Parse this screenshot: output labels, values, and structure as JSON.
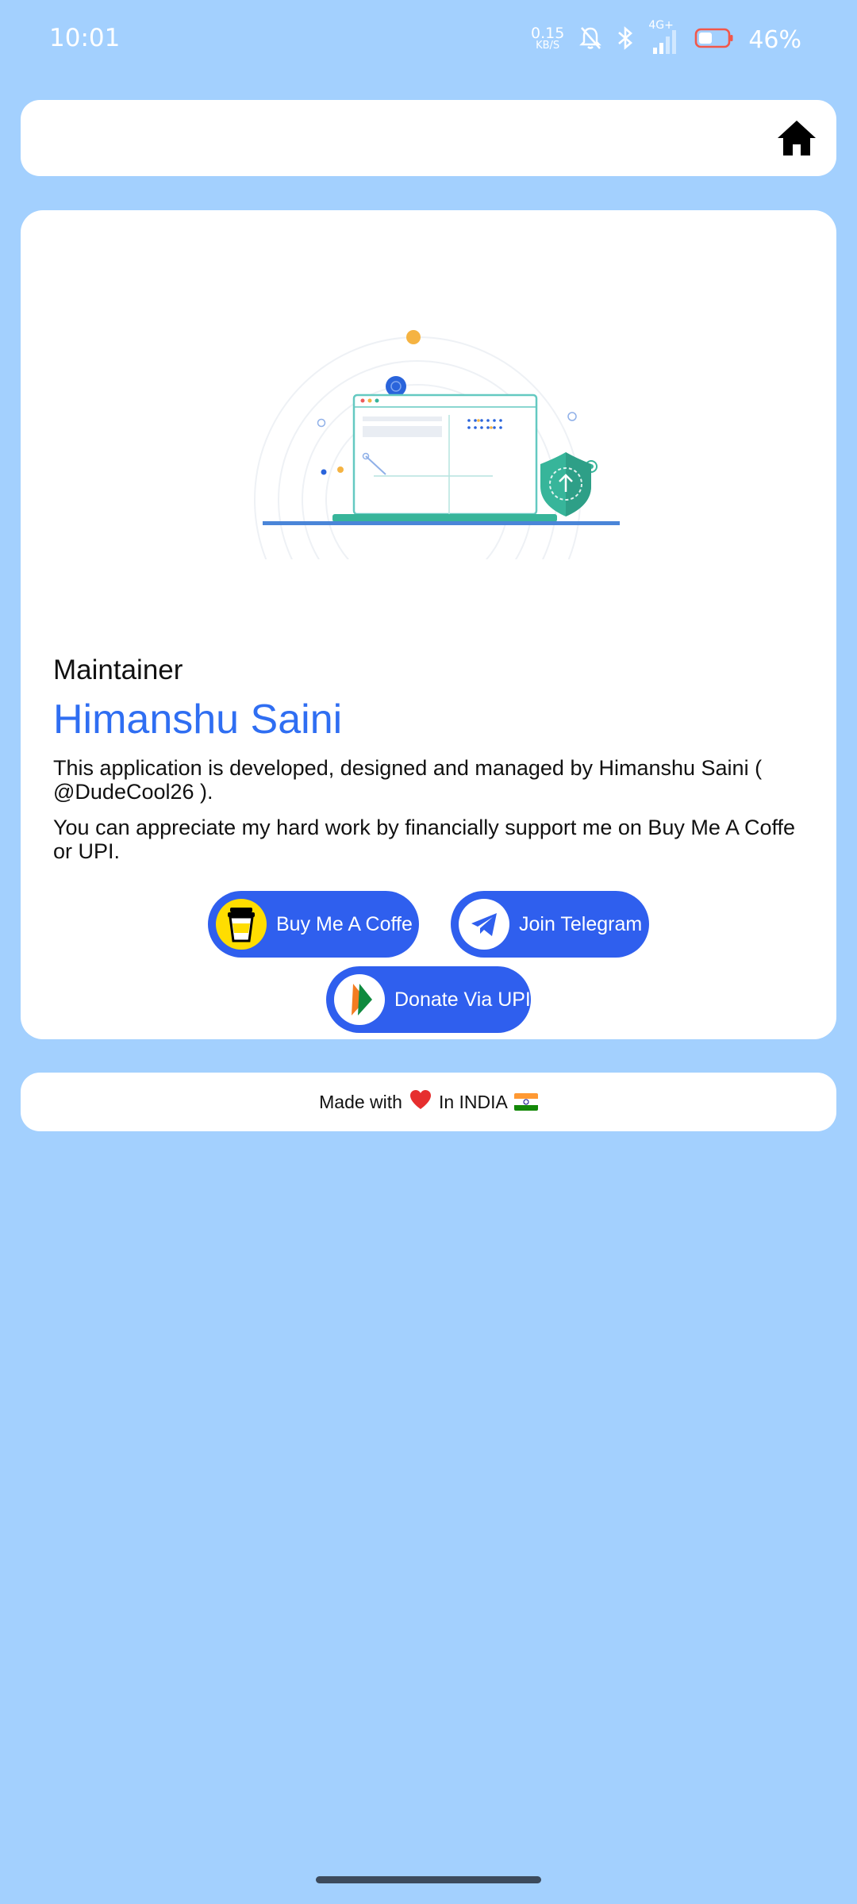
{
  "status_bar": {
    "time": "10:01",
    "net_speed_value": "0.15",
    "net_speed_unit": "KB/S",
    "network_type": "4G+",
    "battery_percent": "46%",
    "icons": [
      "mute-icon",
      "bluetooth-icon",
      "signal-icon",
      "battery-icon"
    ]
  },
  "header": {
    "home_icon": "home-icon"
  },
  "maintainer": {
    "label": "Maintainer",
    "name": "Himanshu Saini",
    "description_line1": "This application is developed, designed and managed by Himanshu Saini ( @DudeCool26 ).",
    "description_line2": "You can appreciate my hard work by financially support me on Buy Me A Coffe or UPI."
  },
  "buttons": {
    "coffee_label": "Buy Me A Coffe",
    "telegram_label": "Join Telegram",
    "upi_label": "Donate Via UPI"
  },
  "footer": {
    "made_with": "Made with",
    "in_country": "In INDIA"
  },
  "colors": {
    "background": "#a3d0fe",
    "accent": "#2f5fee",
    "name_color": "#2f6ef2",
    "card": "#ffffff"
  }
}
